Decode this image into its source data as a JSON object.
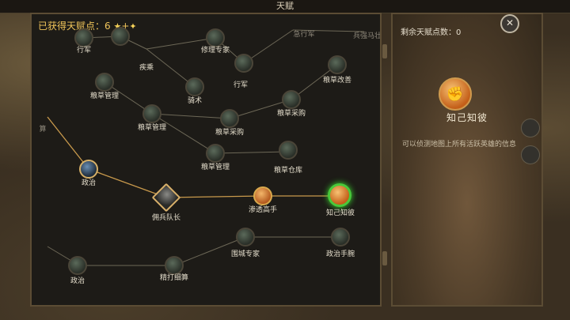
{
  "window_title": "天赋",
  "points_earned_prefix": "已获得天赋点：",
  "points_earned_value": "6",
  "points_earned_plus": "+",
  "remaining_label": "剩余天赋点数：0",
  "close_glyph": "✕",
  "selected_talent": {
    "name": "知己知彼",
    "icon_glyph": "✊",
    "description": "可以侦测地图上所有活跃英雄的信息"
  },
  "nodes": [
    {
      "id": "n1",
      "label": "行军"
    },
    {
      "id": "n2",
      "label": "疾乘"
    },
    {
      "id": "n3",
      "label": "修理专家"
    },
    {
      "id": "n4",
      "label": "急行军"
    },
    {
      "id": "n5",
      "label": "兵强马壮"
    },
    {
      "id": "n6",
      "label": "粮草管理"
    },
    {
      "id": "n7",
      "label": "骑术"
    },
    {
      "id": "n8",
      "label": "行军"
    },
    {
      "id": "n9",
      "label": "粮草改善"
    },
    {
      "id": "n10",
      "label": "粮草管理"
    },
    {
      "id": "n11",
      "label": "粮草采购"
    },
    {
      "id": "n12",
      "label": "粮草采购"
    },
    {
      "id": "n13",
      "label": "算"
    },
    {
      "id": "n14",
      "label": "粮草管理"
    },
    {
      "id": "n15",
      "label": "粮草仓库"
    },
    {
      "id": "n16",
      "label": "政治"
    },
    {
      "id": "n17",
      "label": "佣兵队长"
    },
    {
      "id": "n18",
      "label": "渗透高手"
    },
    {
      "id": "n19",
      "label": "知己知彼"
    },
    {
      "id": "n20",
      "label": "围城专家"
    },
    {
      "id": "n21",
      "label": "政治手腕"
    },
    {
      "id": "n22",
      "label": "政治"
    },
    {
      "id": "n23",
      "label": "精打细算"
    }
  ]
}
